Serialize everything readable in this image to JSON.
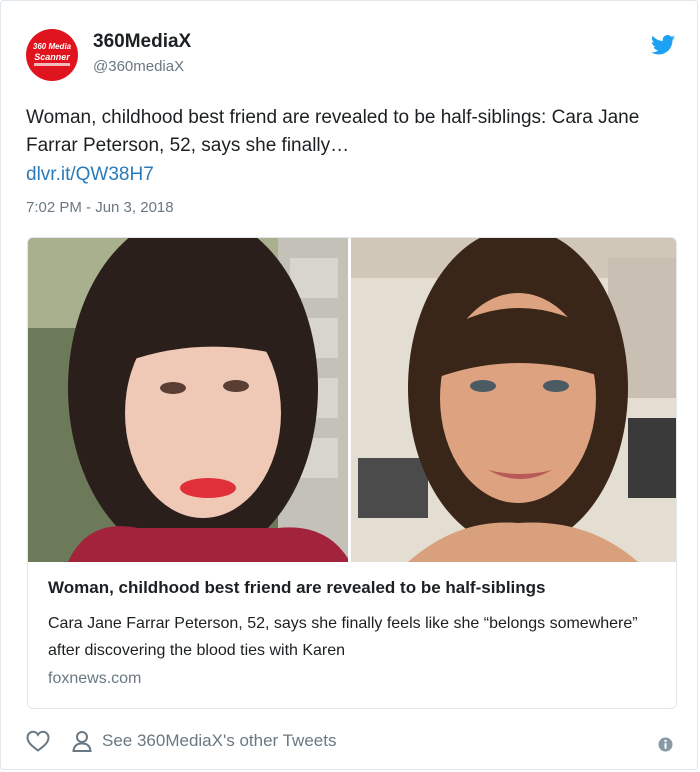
{
  "author": {
    "avatar_text_top": "360 Media",
    "avatar_text_bottom": "Scanner",
    "name": "360MediaX",
    "handle": "@360mediaX"
  },
  "tweet": {
    "text": "Woman, childhood best friend are revealed to be half-siblings: Cara Jane Farrar Peterson, 52, says she finally…",
    "link": "dlvr.it/QW38H7",
    "timestamp": "7:02 PM - Jun 3, 2018"
  },
  "card": {
    "title": "Woman, childhood best friend are revealed to be half-siblings",
    "description": "Cara Jane Farrar Peterson, 52, says she finally feels like she “belongs somewhere” after discovering the blood ties with Karen",
    "domain": "foxnews.com",
    "image_icon": "photo-two-women"
  },
  "actions": {
    "like_icon": "heart-icon",
    "person_icon": "person-icon",
    "other_tweets_label": "See 360MediaX's other Tweets",
    "info_icon": "info-icon"
  },
  "colors": {
    "brand_blue": "#1da1f2",
    "link_blue": "#2b7bb9",
    "secondary_text": "#697882",
    "avatar_red": "#e0141e"
  }
}
